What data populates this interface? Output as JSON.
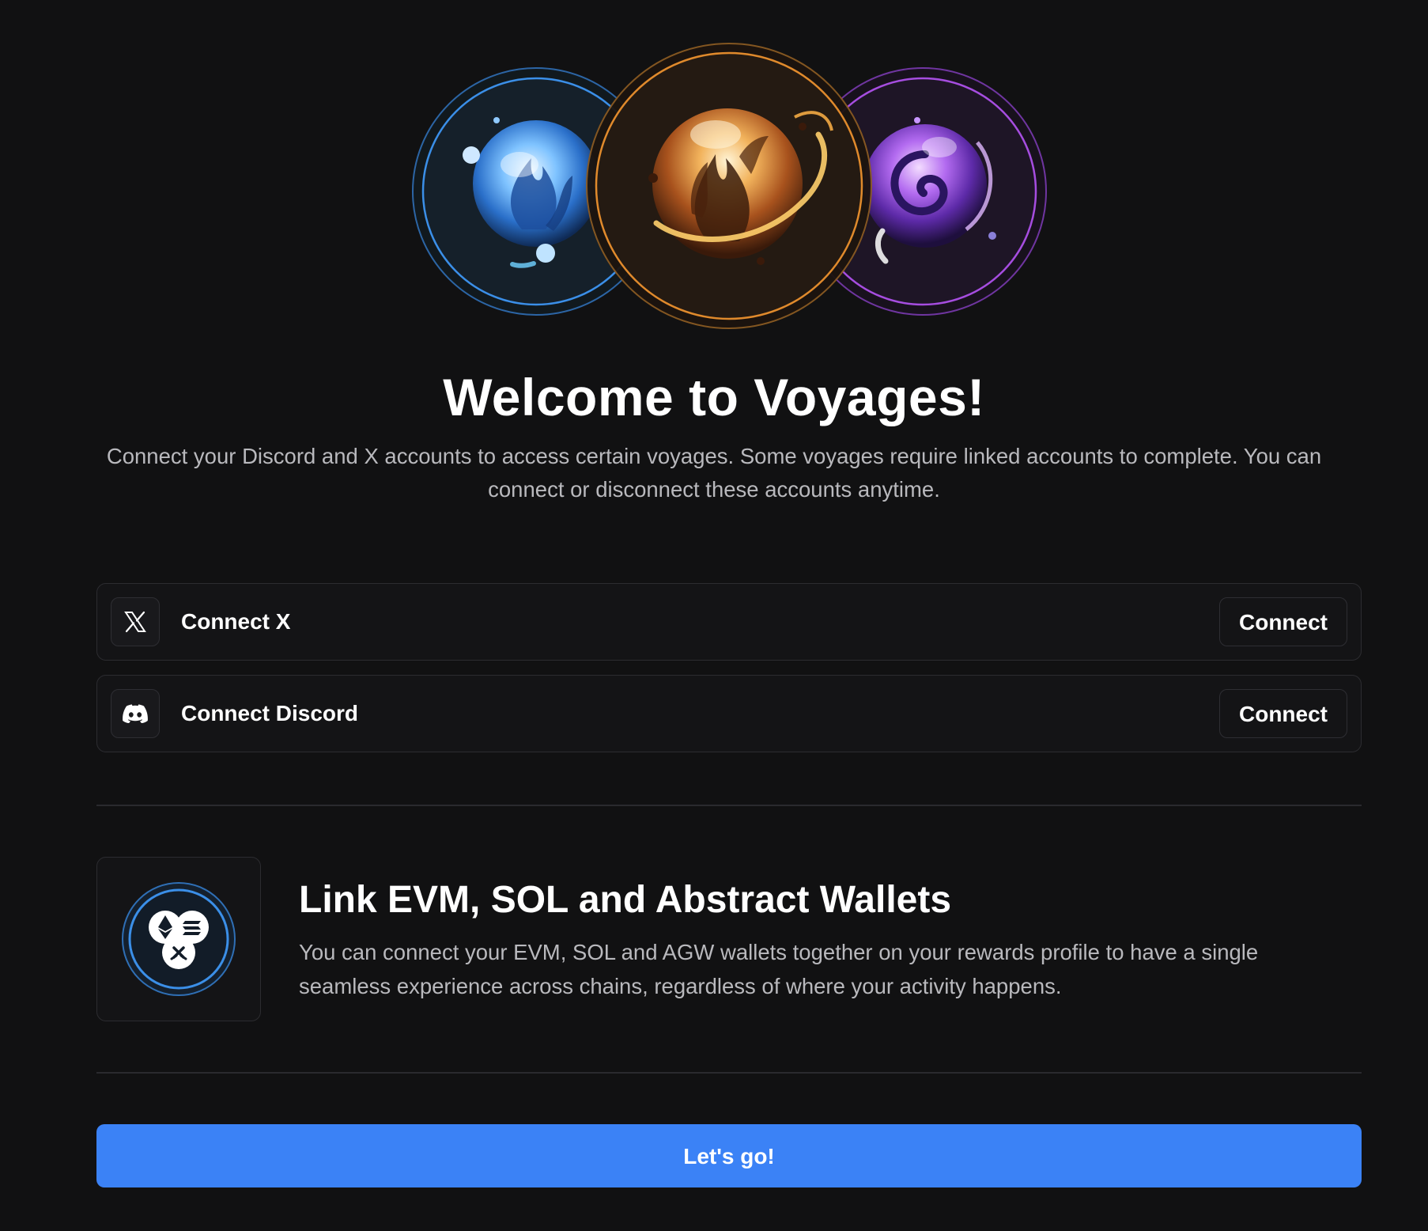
{
  "hero": {
    "orbs": [
      {
        "name": "water-orb",
        "ring_color": "#3b8fe8",
        "glow_color": "#7fc3ff"
      },
      {
        "name": "fire-orb",
        "ring_color": "#e08a2c",
        "glow_color": "#ffd27a"
      },
      {
        "name": "void-orb",
        "ring_color": "#a64de0",
        "glow_color": "#c98cff"
      }
    ]
  },
  "header": {
    "title": "Welcome to Voyages!",
    "subtitle": "Connect your Discord and X accounts to access certain voyages. Some voyages require linked accounts to complete. You can connect or disconnect these accounts anytime."
  },
  "connections": {
    "x": {
      "icon": "x-logo-icon",
      "label": "Connect X",
      "button": "Connect"
    },
    "discord": {
      "icon": "discord-icon",
      "label": "Connect Discord",
      "button": "Connect"
    }
  },
  "wallets": {
    "icon": "multi-chain-wallet-icon",
    "title": "Link EVM, SOL and Abstract Wallets",
    "description": "You can connect your EVM, SOL and AGW wallets together on your rewards profile to have a single seamless experience across chains, regardless of where your activity happens."
  },
  "cta": {
    "label": "Let's go!"
  },
  "colors": {
    "background": "#111112",
    "accent": "#3b82f6",
    "muted_text": "#b9b9bd",
    "border": "#2c2c30"
  }
}
